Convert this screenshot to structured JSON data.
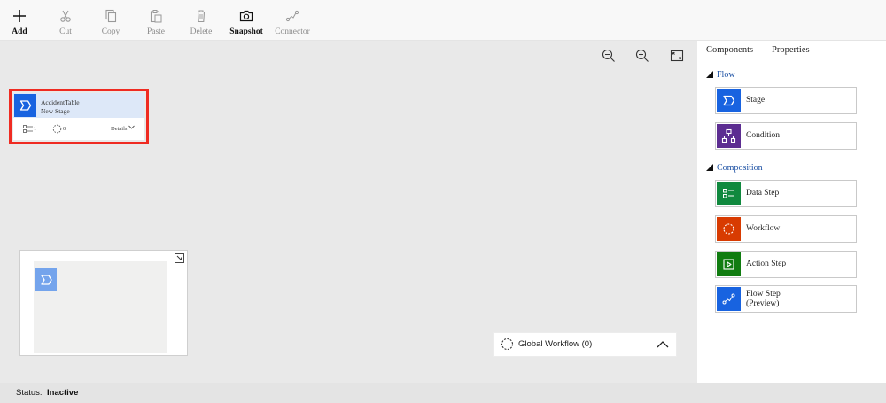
{
  "toolbar": {
    "add": "Add",
    "cut": "Cut",
    "copy": "Copy",
    "paste": "Paste",
    "delete": "Delete",
    "snapshot": "Snapshot",
    "connector": "Connector"
  },
  "canvas": {
    "stage": {
      "title": "AccidentTable",
      "subtitle": "New Stage",
      "steps_count": "1",
      "workflows_count": "0",
      "details_label": "Details"
    },
    "global_workflow_label": "Global Workflow (0)"
  },
  "panel": {
    "tabs": [
      "Components",
      "Properties"
    ],
    "sections": [
      {
        "title": "Flow",
        "items": [
          {
            "label": "Stage",
            "color": "#1863e0",
            "icon": "stage-icon"
          },
          {
            "label": "Condition",
            "color": "#5c2d91",
            "icon": "condition-icon"
          }
        ]
      },
      {
        "title": "Composition",
        "items": [
          {
            "label": "Data Step",
            "color": "#10893e",
            "icon": "data-step-icon"
          },
          {
            "label": "Workflow",
            "color": "#d83b01",
            "icon": "workflow-icon"
          },
          {
            "label": "Action Step",
            "color": "#107c10",
            "icon": "action-step-icon"
          },
          {
            "label": "Flow Step",
            "label2": "(Preview)",
            "color": "#1863e0",
            "icon": "flow-step-icon"
          }
        ]
      }
    ]
  },
  "status": {
    "label": "Status:",
    "value": "Inactive"
  },
  "colors": {
    "highlight": "#ef2b22",
    "stage_blue": "#1863e0",
    "section_title": "#1a4fa3"
  }
}
